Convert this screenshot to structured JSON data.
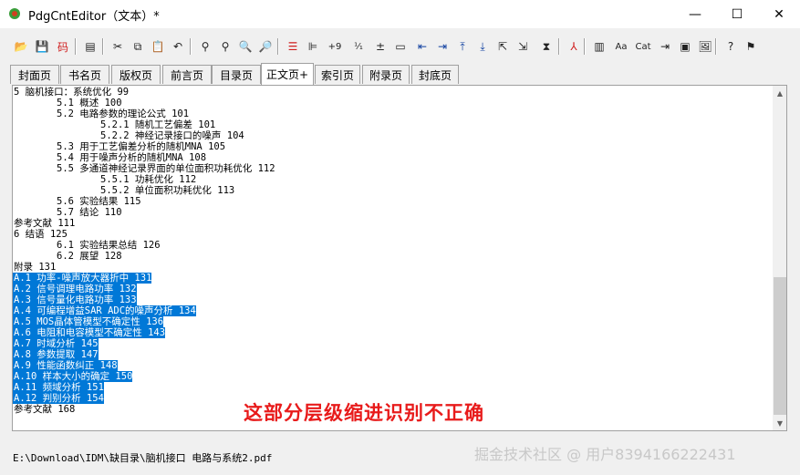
{
  "window": {
    "title": "PdgCntEditor（文本）*"
  },
  "toolbar": {
    "items": [
      {
        "name": "open-folder-icon",
        "glyph": "📂"
      },
      {
        "name": "save-icon",
        "glyph": "💾"
      },
      {
        "name": "encoding-icon",
        "glyph": "码"
      },
      {
        "name": "outline-icon",
        "glyph": "▤"
      },
      {
        "name": "cut-icon",
        "glyph": "✂"
      },
      {
        "name": "copy-icon",
        "glyph": "⧉"
      },
      {
        "name": "paste-icon",
        "glyph": "📋"
      },
      {
        "name": "undo-icon",
        "glyph": "↶"
      },
      {
        "name": "find-icon",
        "glyph": "⚲"
      },
      {
        "name": "find-next-icon",
        "glyph": "⚲"
      },
      {
        "name": "replace-icon",
        "glyph": "🔍"
      },
      {
        "name": "find-page-icon",
        "glyph": "🔎"
      },
      {
        "name": "align-left-icon",
        "glyph": "☰"
      },
      {
        "name": "align-icon",
        "glyph": "⊫"
      },
      {
        "name": "add-page-number-icon",
        "glyph": "+9"
      },
      {
        "name": "page-number-icon",
        "glyph": "¹⁄₁"
      },
      {
        "name": "plus-minus-icon",
        "glyph": "±"
      },
      {
        "name": "document-icon",
        "glyph": "▭"
      },
      {
        "name": "indent-decrease-icon",
        "glyph": "⇤"
      },
      {
        "name": "indent-increase-icon",
        "glyph": "⇥"
      },
      {
        "name": "move-up-icon",
        "glyph": "⤒"
      },
      {
        "name": "move-down-icon",
        "glyph": "⤓"
      },
      {
        "name": "level-up-icon",
        "glyph": "⇱"
      },
      {
        "name": "level-down-icon",
        "glyph": "⇲"
      },
      {
        "name": "fit-icon",
        "glyph": "⧗"
      },
      {
        "name": "pdf-icon",
        "glyph": "⅄"
      },
      {
        "name": "columns-icon",
        "glyph": "▥"
      },
      {
        "name": "font-icon",
        "glyph": "Aa"
      },
      {
        "name": "cat-icon",
        "glyph": "Cat"
      },
      {
        "name": "insert-icon",
        "glyph": "⇥"
      },
      {
        "name": "window-icon",
        "glyph": "▣"
      },
      {
        "name": "image-icon",
        "glyph": "🖼"
      },
      {
        "name": "help-icon",
        "glyph": "?"
      },
      {
        "name": "about-icon",
        "glyph": "⚑"
      }
    ]
  },
  "tabs": [
    {
      "label": "封面页",
      "active": false
    },
    {
      "label": "书名页",
      "active": false
    },
    {
      "label": "版权页",
      "active": false
    },
    {
      "label": "前言页",
      "active": false
    },
    {
      "label": "目录页",
      "active": false
    },
    {
      "label": "正文页+",
      "active": true
    },
    {
      "label": "索引页",
      "active": false
    },
    {
      "label": "附录页",
      "active": false
    },
    {
      "label": "封底页",
      "active": false
    }
  ],
  "editor": {
    "lines": [
      {
        "text": "5 脑机接口：系统优化 99",
        "indent": 0,
        "selected": false
      },
      {
        "text": "5.1 概述 100",
        "indent": 1,
        "selected": false
      },
      {
        "text": "5.2 电路参数的理论公式 101",
        "indent": 1,
        "selected": false
      },
      {
        "text": "5.2.1 随机工艺偏差 101",
        "indent": 2,
        "selected": false
      },
      {
        "text": "5.2.2 神经记录接口的噪声 104",
        "indent": 2,
        "selected": false
      },
      {
        "text": "5.3 用于工艺偏差分析的随机MNA 105",
        "indent": 1,
        "selected": false
      },
      {
        "text": "5.4 用于噪声分析的随机MNA 108",
        "indent": 1,
        "selected": false
      },
      {
        "text": "5.5 多通道神经记录界面的单位面积功耗优化 112",
        "indent": 1,
        "selected": false
      },
      {
        "text": "5.5.1 功耗优化 112",
        "indent": 2,
        "selected": false
      },
      {
        "text": "5.5.2 单位面积功耗优化 113",
        "indent": 2,
        "selected": false
      },
      {
        "text": "5.6 实验结果 115",
        "indent": 1,
        "selected": false
      },
      {
        "text": "5.7 结论 110",
        "indent": 1,
        "selected": false
      },
      {
        "text": "参考文献 111",
        "indent": 0,
        "selected": false
      },
      {
        "text": "6 结语 125",
        "indent": 0,
        "selected": false
      },
      {
        "text": "6.1 实验结果总结 126",
        "indent": 1,
        "selected": false
      },
      {
        "text": "6.2 展望 128",
        "indent": 1,
        "selected": false
      },
      {
        "text": "附录 131",
        "indent": 0,
        "selected": false
      },
      {
        "text": "A.1 功率-噪声放大器折中 131",
        "indent": 0,
        "selected": true
      },
      {
        "text": "A.2 信号调理电路功率 132",
        "indent": 0,
        "selected": true
      },
      {
        "text": "A.3 信号量化电路功率 133",
        "indent": 0,
        "selected": true
      },
      {
        "text": "A.4 可编程增益SAR ADC的噪声分析 134",
        "indent": 0,
        "selected": true
      },
      {
        "text": "A.5 MOS晶体管模型不确定性 136",
        "indent": 0,
        "selected": true
      },
      {
        "text": "A.6 电阻和电容模型不确定性 143",
        "indent": 0,
        "selected": true
      },
      {
        "text": "A.7 时域分析 145",
        "indent": 0,
        "selected": true
      },
      {
        "text": "A.8 参数提取 147",
        "indent": 0,
        "selected": true
      },
      {
        "text": "A.9 性能函数纠正 148",
        "indent": 0,
        "selected": true
      },
      {
        "text": "A.10 样本大小的确定 150",
        "indent": 0,
        "selected": true
      },
      {
        "text": "A.11 频域分析 151",
        "indent": 0,
        "selected": true
      },
      {
        "text": "A.12 判别分析 154",
        "indent": 0,
        "selected": true
      },
      {
        "text": "参考文献 168",
        "indent": 0,
        "selected": false
      }
    ],
    "annotation": "这部分层级缩进识别不正确"
  },
  "status": {
    "path": "E:\\Download\\IDM\\缺目录\\脑机接口 电路与系统2.pdf"
  },
  "watermark": "掘金技术社区 @ 用户8394166222431",
  "colors": {
    "selection": "#0078d7",
    "annotation": "#e81b1b"
  }
}
